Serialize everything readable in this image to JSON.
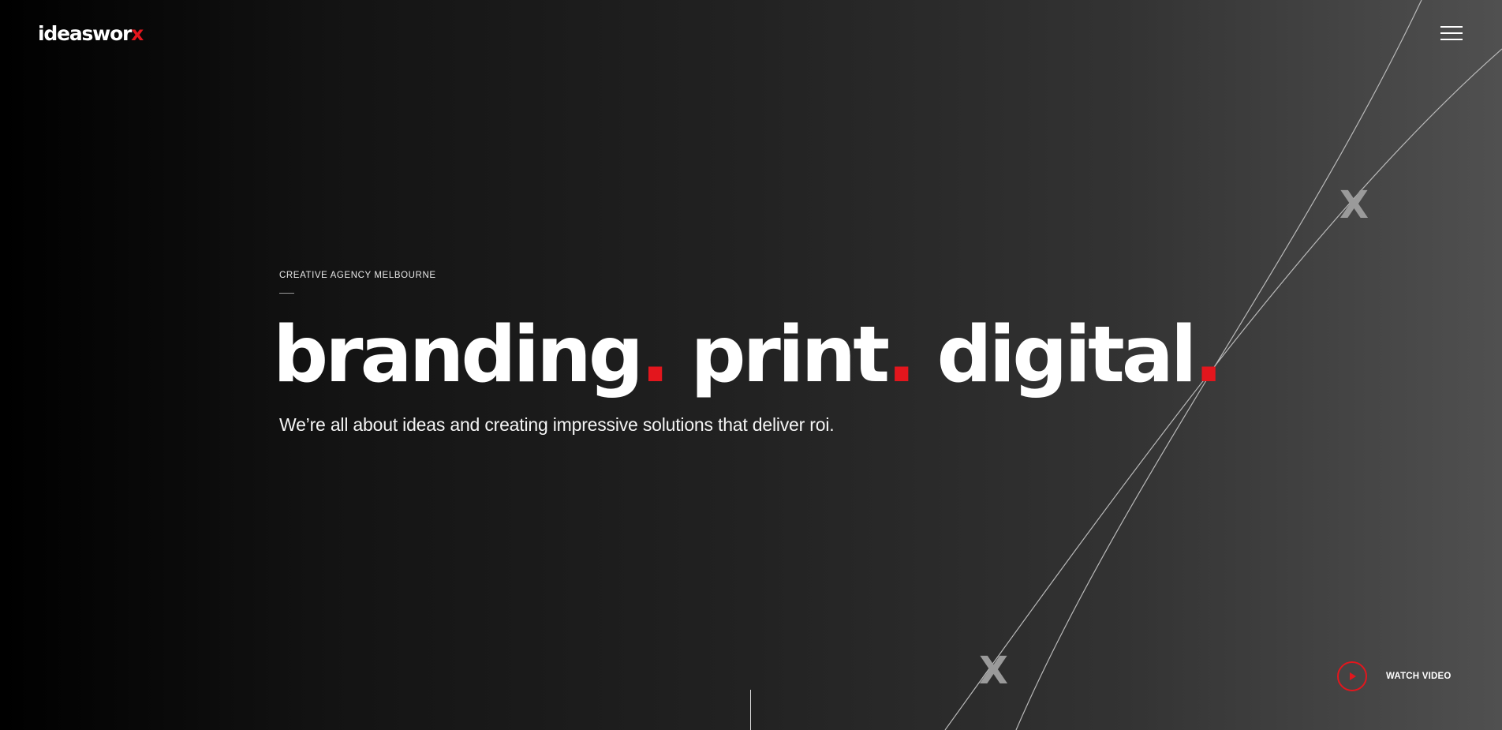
{
  "header": {
    "logo_text": "ideaswor",
    "logo_accent": "x",
    "menu_icon": "hamburger-icon"
  },
  "hero": {
    "eyebrow": "CREATIVE AGENCY MELBOURNE",
    "headline_words": [
      "branding",
      "print",
      "digital"
    ],
    "headline_dot": ".",
    "subline": "We’re all about ideas and creating impressive solutions that deliver roi.",
    "watermark_glyph": "X"
  },
  "video": {
    "label": "WATCH VIDEO",
    "icon": "play-icon"
  },
  "colors": {
    "accent": "#e3161d",
    "text": "#ffffff",
    "background_dark": "#000000",
    "background_light": "#505050",
    "watermark": "#9a9a9a"
  }
}
